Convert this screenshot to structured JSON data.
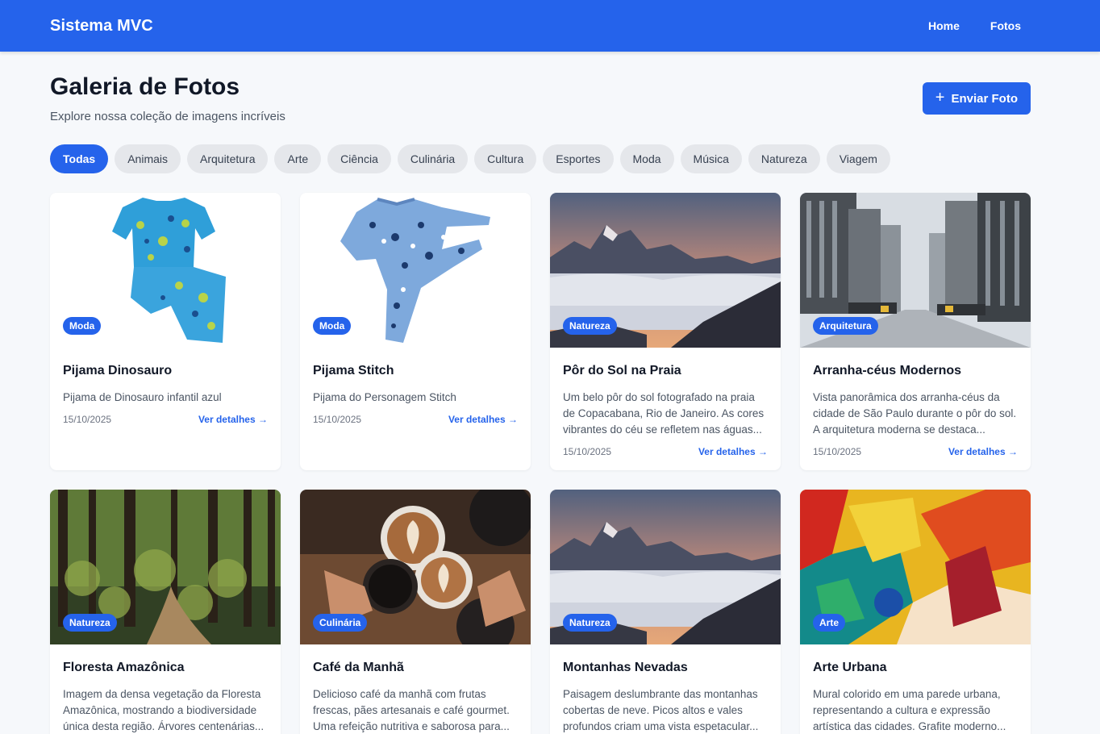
{
  "navbar": {
    "brand": "Sistema MVC",
    "links": [
      "Home",
      "Fotos"
    ]
  },
  "header": {
    "title": "Galeria de Fotos",
    "subtitle": "Explore nossa coleção de imagens incríveis",
    "upload_label": "Enviar Foto"
  },
  "filters": [
    "Todas",
    "Animais",
    "Arquitetura",
    "Arte",
    "Ciência",
    "Culinária",
    "Cultura",
    "Esportes",
    "Moda",
    "Música",
    "Natureza",
    "Viagem"
  ],
  "active_filter": "Todas",
  "cards": [
    {
      "category": "Moda",
      "title": "Pijama Dinosauro",
      "description": "Pijama de Dinosauro infantil azul",
      "date": "15/10/2025",
      "link": "Ver detalhes →"
    },
    {
      "category": "Moda",
      "title": "Pijama Stitch",
      "description": "Pijama do Personagem Stitch",
      "date": "15/10/2025",
      "link": "Ver detalhes →"
    },
    {
      "category": "Natureza",
      "title": "Pôr do Sol na Praia",
      "description": "Um belo pôr do sol fotografado na praia de Copacabana, Rio de Janeiro. As cores vibrantes do céu se refletem nas águas...",
      "date": "15/10/2025",
      "link": "Ver detalhes →"
    },
    {
      "category": "Arquitetura",
      "title": "Arranha-céus Modernos",
      "description": "Vista panorâmica dos arranha-céus da cidade de São Paulo durante o pôr do sol. A arquitetura moderna se destaca...",
      "date": "15/10/2025",
      "link": "Ver detalhes →"
    },
    {
      "category": "Natureza",
      "title": "Floresta Amazônica",
      "description": "Imagem da densa vegetação da Floresta Amazônica, mostrando a biodiversidade única desta região. Árvores centenárias...",
      "date": "",
      "link": ""
    },
    {
      "category": "Culinária",
      "title": "Café da Manhã",
      "description": "Delicioso café da manhã com frutas frescas, pães artesanais e café gourmet. Uma refeição nutritiva e saborosa para...",
      "date": "",
      "link": ""
    },
    {
      "category": "Natureza",
      "title": "Montanhas Nevadas",
      "description": "Paisagem deslumbrante das montanhas cobertas de neve. Picos altos e vales profundos criam uma vista espetacular...",
      "date": "",
      "link": ""
    },
    {
      "category": "Arte",
      "title": "Arte Urbana",
      "description": "Mural colorido em uma parede urbana, representando a cultura e expressão artística das cidades. Grafite moderno...",
      "date": "",
      "link": ""
    }
  ]
}
